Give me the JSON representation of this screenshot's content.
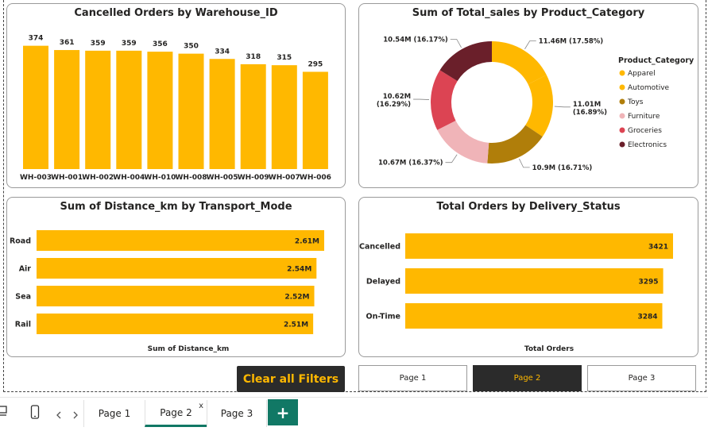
{
  "colors": {
    "bar": "#FFB800",
    "active_bg": "#2b2b2b",
    "active_text": "#FFB800",
    "tab_accent": "#117865"
  },
  "chart_data": [
    {
      "type": "bar",
      "title": "Cancelled Orders by Warehouse_ID",
      "categories": [
        "WH-003",
        "WH-001",
        "WH-002",
        "WH-004",
        "WH-010",
        "WH-008",
        "WH-005",
        "WH-009",
        "WH-007",
        "WH-006"
      ],
      "values": [
        374,
        361,
        359,
        359,
        356,
        350,
        334,
        318,
        315,
        295
      ],
      "data_labels": [
        "374",
        "361",
        "359",
        "359",
        "356",
        "350",
        "334",
        "318",
        "315",
        "295"
      ],
      "ylim": [
        0,
        390
      ],
      "grid": false
    },
    {
      "type": "pie",
      "title": "Sum of Total_sales by Product_Category",
      "legend_title": "Product_Category",
      "legend_position": "right",
      "categories": [
        "Apparel",
        "Automotive",
        "Toys",
        "Furniture",
        "Groceries",
        "Electronics"
      ],
      "values": [
        11.46,
        11.01,
        10.9,
        10.67,
        10.62,
        10.54
      ],
      "percent": [
        17.58,
        16.89,
        16.71,
        16.37,
        16.29,
        16.17
      ],
      "colors": [
        "#FFB800",
        "#FFB800",
        "#B07E0A",
        "#F0B4B8",
        "#DC4453",
        "#6A1F2A"
      ],
      "data_labels": [
        "11.46M (17.58%)",
        "11.01M (16.89%)",
        "10.9M (16.71%)",
        "10.67M (16.37%)",
        "10.62M (16.29%)",
        "10.54M (16.17%)"
      ]
    },
    {
      "type": "bar",
      "orientation": "horizontal",
      "title": "Sum of Distance_km by Transport_Mode",
      "xlabel": "Sum of Distance_km",
      "categories": [
        "Road",
        "Air",
        "Sea",
        "Rail"
      ],
      "values": [
        2.61,
        2.54,
        2.52,
        2.51
      ],
      "data_labels": [
        "2.61M",
        "2.54M",
        "2.52M",
        "2.51M"
      ],
      "xlim": [
        0,
        2.61
      ],
      "grid": false
    },
    {
      "type": "bar",
      "orientation": "horizontal",
      "title": "Total Orders by Delivery_Status",
      "xlabel": "Total Orders",
      "categories": [
        "Cancelled",
        "Delayed",
        "On-Time"
      ],
      "values": [
        3421,
        3295,
        3284
      ],
      "data_labels": [
        "3421",
        "3295",
        "3284"
      ],
      "xlim": [
        0,
        3421
      ],
      "grid": false
    }
  ],
  "buttons": {
    "clear_filters": "Clear all Filters"
  },
  "nav_buttons": [
    {
      "label": "Page 1",
      "active": false
    },
    {
      "label": "Page 2",
      "active": true
    },
    {
      "label": "Page 3",
      "active": false
    }
  ],
  "tabs": [
    {
      "label": "Page 1",
      "active": false
    },
    {
      "label": "Page 2",
      "active": true
    },
    {
      "label": "Page 3",
      "active": false
    }
  ],
  "tab_close": "x",
  "icons": {
    "desktop": "desktop-icon",
    "mobile": "mobile-icon",
    "prev": "chevron-left-icon",
    "next": "chevron-right-icon",
    "add": "plus-icon"
  }
}
